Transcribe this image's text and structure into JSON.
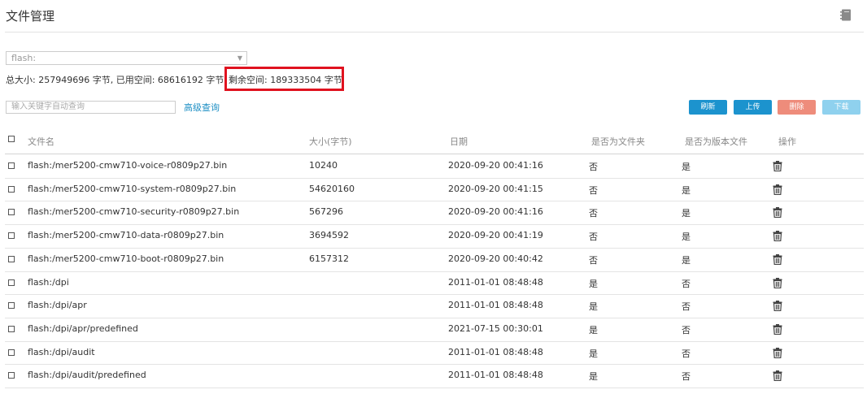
{
  "page": {
    "title": "文件管理"
  },
  "storage": {
    "selected": "flash:",
    "total_label": "总大小:",
    "total_value": "257949696 字节,",
    "used_label": "已用空间:",
    "used_value": "68616192 字节,",
    "remaining_label": "剩余空间:",
    "remaining_value": "189333504 字节"
  },
  "search": {
    "placeholder": "输入关键字自动查询",
    "advanced_label": "高级查询"
  },
  "toolbar": {
    "refresh": "刷新",
    "upload": "上传",
    "delete": "删除",
    "download": "下载"
  },
  "colors": {
    "primary": "#1c93ce",
    "danger": "#ee8c7b",
    "disabled": "#8fd1ee",
    "highlight_border": "#e0121f",
    "link": "#1e8fc4"
  },
  "table": {
    "headers": {
      "name": "文件名",
      "size": "大小(字节)",
      "date": "日期",
      "is_folder": "是否为文件夹",
      "is_version": "是否为版本文件",
      "action": "操作"
    },
    "rows": [
      {
        "name": "flash:/mer5200-cmw710-voice-r0809p27.bin",
        "size": "10240",
        "date": "2020-09-20 00:41:16",
        "is_folder": "否",
        "is_version": "是"
      },
      {
        "name": "flash:/mer5200-cmw710-system-r0809p27.bin",
        "size": "54620160",
        "date": "2020-09-20 00:41:15",
        "is_folder": "否",
        "is_version": "是"
      },
      {
        "name": "flash:/mer5200-cmw710-security-r0809p27.bin",
        "size": "567296",
        "date": "2020-09-20 00:41:16",
        "is_folder": "否",
        "is_version": "是"
      },
      {
        "name": "flash:/mer5200-cmw710-data-r0809p27.bin",
        "size": "3694592",
        "date": "2020-09-20 00:41:19",
        "is_folder": "否",
        "is_version": "是"
      },
      {
        "name": "flash:/mer5200-cmw710-boot-r0809p27.bin",
        "size": "6157312",
        "date": "2020-09-20 00:40:42",
        "is_folder": "否",
        "is_version": "是"
      },
      {
        "name": "flash:/dpi",
        "size": "",
        "date": "2011-01-01 08:48:48",
        "is_folder": "是",
        "is_version": "否"
      },
      {
        "name": "flash:/dpi/apr",
        "size": "",
        "date": "2011-01-01 08:48:48",
        "is_folder": "是",
        "is_version": "否"
      },
      {
        "name": "flash:/dpi/apr/predefined",
        "size": "",
        "date": "2021-07-15 00:30:01",
        "is_folder": "是",
        "is_version": "否"
      },
      {
        "name": "flash:/dpi/audit",
        "size": "",
        "date": "2011-01-01 08:48:48",
        "is_folder": "是",
        "is_version": "否"
      },
      {
        "name": "flash:/dpi/audit/predefined",
        "size": "",
        "date": "2011-01-01 08:48:48",
        "is_folder": "是",
        "is_version": "否"
      }
    ]
  }
}
